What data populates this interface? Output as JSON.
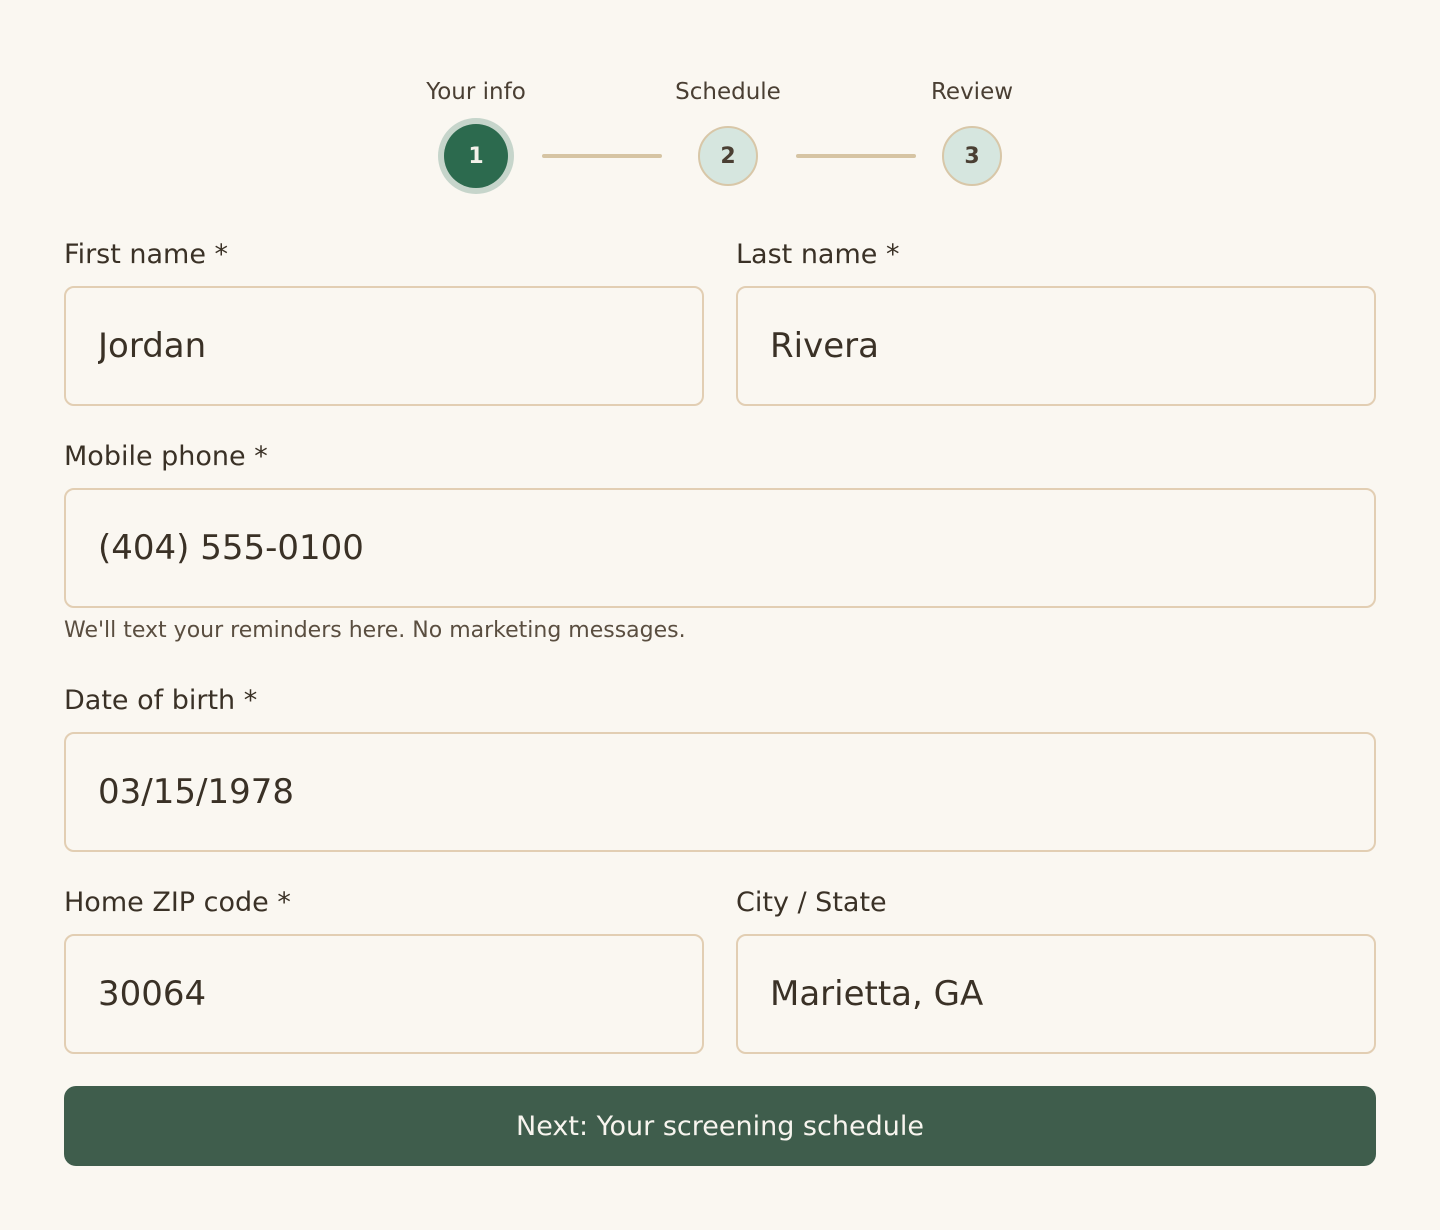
{
  "stepper": {
    "steps": [
      {
        "label": "Your info",
        "number": "1",
        "state": "active"
      },
      {
        "label": "Schedule",
        "number": "2",
        "state": "inactive"
      },
      {
        "label": "Review",
        "number": "3",
        "state": "inactive"
      }
    ]
  },
  "form": {
    "first_name": {
      "label": "First name *",
      "value": "Jordan"
    },
    "last_name": {
      "label": "Last name *",
      "value": "Rivera"
    },
    "mobile_phone": {
      "label": "Mobile phone *",
      "value": "(404) 555-0100",
      "helper": "We'll text your reminders here. No marketing messages."
    },
    "date_of_birth": {
      "label": "Date of birth *",
      "value": "03/15/1978"
    },
    "zip": {
      "label": "Home ZIP code *",
      "value": "30064"
    },
    "city_state": {
      "label": "City / State",
      "value": "Marietta, GA"
    }
  },
  "actions": {
    "next_label": "Next: Your screening schedule"
  },
  "colors": {
    "background": "#faf7f1",
    "accent": "#2c6a4e",
    "button": "#3f5d4c",
    "border": "#e2ceb3"
  }
}
